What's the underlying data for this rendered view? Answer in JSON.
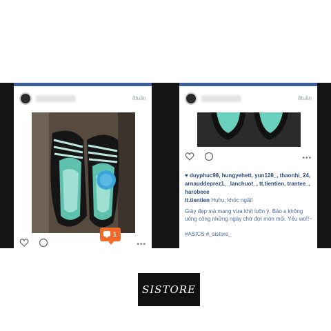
{
  "brand": {
    "logo_text": "SISTORE"
  },
  "colors": {
    "accent_bar": "#3b5f9a",
    "link": "#2d4a7c",
    "notification": "#f26a2a",
    "backdrop": "#141414"
  },
  "left_post": {
    "timestamp": "8tuần",
    "notification_count": "1",
    "icons": [
      "heart-icon",
      "comment-icon",
      "more-dots-icon"
    ],
    "more": "•••"
  },
  "right_post": {
    "timestamp": "8tuần",
    "icons": [
      "heart-icon",
      "comment-icon",
      "more-dots-icon"
    ],
    "more": "•••",
    "likes": "duyphuc98, hungyehett, yun128_, thaonhi_24, arnauddeprez1, _lanchuot_, tt.tientien, trantee_, harobeee",
    "comment1_user": "tt.tientien",
    "comment1_text": "Huhu, khóc ngất!",
    "comment2_text": "Giày đẹp mà mang vừa khít luôn ý. Bảo s không uống công những ngày chờ đợi mòn mỏi. Yêu wo!!~",
    "hashtags": "#ASICS #_sistore_"
  }
}
